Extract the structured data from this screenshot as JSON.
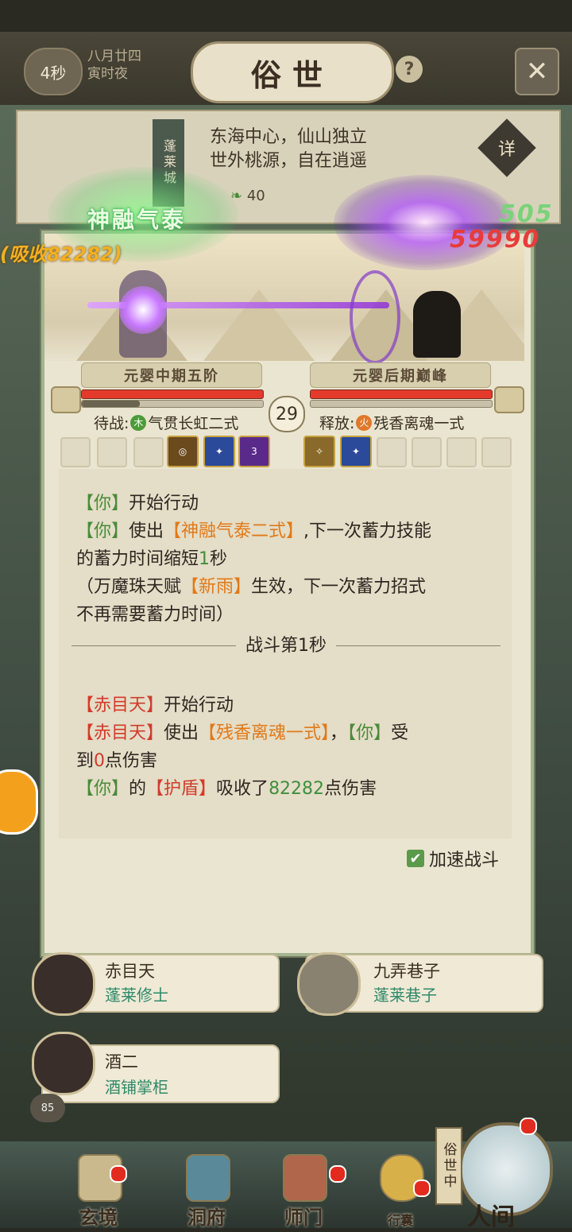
{
  "header": {
    "timer": "4秒",
    "date_line1": "八月廿四",
    "date_line2": "寅时夜",
    "title": "俗世",
    "help": "?",
    "close": "✕"
  },
  "location": {
    "name": "蓬莱城",
    "desc_line1": "东海中心，仙山独立",
    "desc_line2": "世外桃源，自在逍遥",
    "detail_label": "详",
    "stat": "40"
  },
  "effects": {
    "skill_name": "神融气泰",
    "absorb_text": "(吸收82282)",
    "dmg_green": "505",
    "dmg_red": "59990"
  },
  "battle": {
    "player_rank": "元婴中期五阶",
    "enemy_rank": "元婴后期巅峰",
    "round": "29",
    "player_state_label": "待战:",
    "player_element": "木",
    "player_move": "气贯长虹二式",
    "enemy_state_label": "释放:",
    "enemy_element": "火",
    "enemy_move": "残香离魂一式",
    "player_hp": 1.0,
    "player_mp": 0.32,
    "enemy_hp": 1.0,
    "enemy_mp": 0.0,
    "skill_badge": "3"
  },
  "log": {
    "l1_tag": "【你】",
    "l1_text": "开始行动",
    "l2_tag": "【你】",
    "l2_pre": "使出",
    "l2_skill": "【神融气泰二式】",
    "l2_post": ",下一次蓄力技能",
    "l3_pre": "的蓄力时间缩短",
    "l3_num": "1",
    "l3_post": "秒",
    "l4_pre": "（万魔珠天赋",
    "l4_skill": "【新雨】",
    "l4_post": "生效，下一次蓄力招式",
    "l5": "不再需要蓄力时间）",
    "divider": "战斗第1秒",
    "l6_tag": "【赤目天】",
    "l6_text": "开始行动",
    "l7_tag": "【赤目天】",
    "l7_pre": "使出",
    "l7_skill": "【残香离魂一式】",
    "l7_mid": "，",
    "l7_you": "【你】",
    "l7_post": "受",
    "l8_pre": "到",
    "l8_num": "0",
    "l8_post": "点伤害",
    "l9_tag": "【你】",
    "l9_pre": "的",
    "l9_shield": "【护盾】",
    "l9_mid": "吸收了",
    "l9_num": "82282",
    "l9_post": "点伤害",
    "speed_label": "加速战斗"
  },
  "npcs": [
    {
      "name": "赤目天",
      "role": "蓬莱修士"
    },
    {
      "name": "九弄巷子",
      "role": "蓬莱巷子"
    },
    {
      "name": "酒二",
      "role": "酒铺掌柜"
    }
  ],
  "chat_count": "85",
  "nav": {
    "items": [
      "玄境",
      "洞府",
      "师门",
      "行囊"
    ],
    "world_tag": "俗世中",
    "world_label": "人间"
  },
  "colors": {
    "accent_green": "#3f8f3f",
    "accent_orange": "#e07a1a",
    "accent_red": "#d23b2b"
  }
}
